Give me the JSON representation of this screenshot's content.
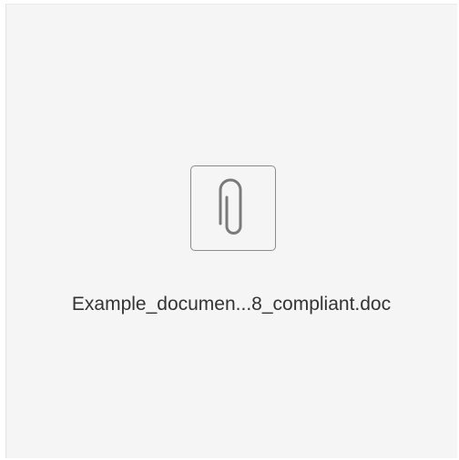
{
  "attachment": {
    "file_name": "Example_documen...8_compliant.doc",
    "icon": "paperclip-icon"
  },
  "colors": {
    "card_background": "#f5f5f5",
    "icon_stroke": "#7a7a7a",
    "text": "#333333"
  }
}
